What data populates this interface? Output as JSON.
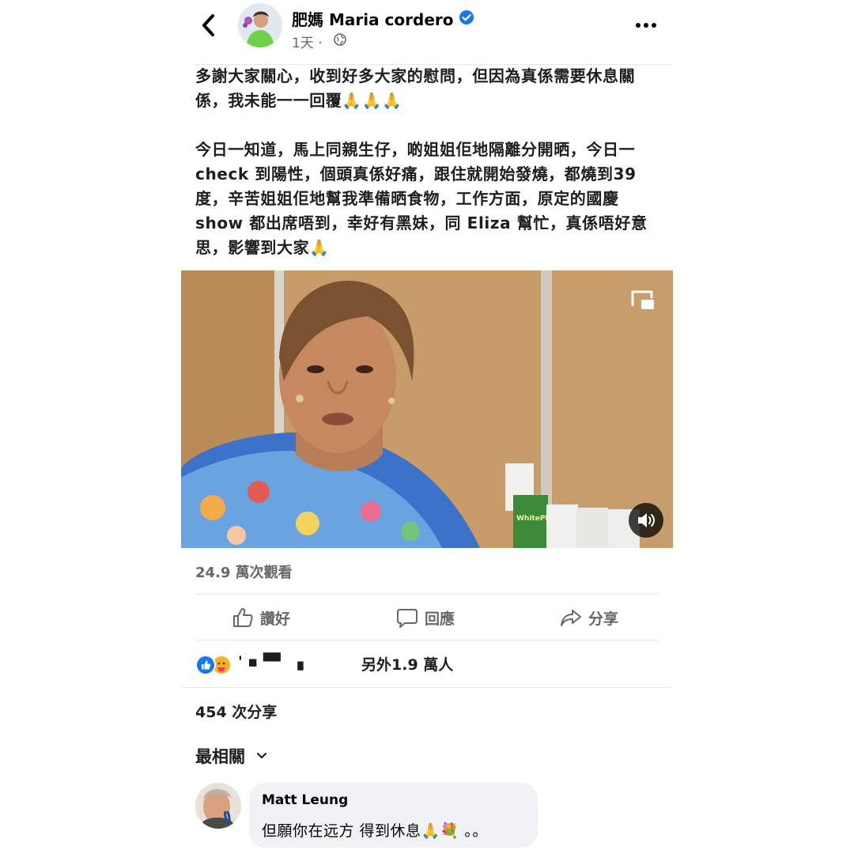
{
  "post": {
    "author": "肥媽 Maria cordero",
    "time": "1天 ·",
    "paragraphs": [
      "多謝大家關心，收到好多大家的慰問，但因為真係需要休息關係，我未能一一回覆🙏🙏🙏",
      "今日一知道，馬上同親生仔，啲姐姐佢地隔離分開晒，今日一check 到陽性，個頭真係好痛，跟住就開始發燒，都燒到39度，辛苦姐姐佢地幫我準備晒食物，工作方面，原定的國慶 show 都出席唔到，幸好有黑妹，同 Eliza 幫忙，真係唔好意思，影響到大家🙏"
    ]
  },
  "video": {
    "views": "24.9 萬次觀看",
    "product_label": "WhitePlant"
  },
  "actions": {
    "like": "讚好",
    "comment": "回應",
    "share": "分享"
  },
  "reactions": {
    "names": "'        ▪ ▀▘ ▗",
    "others": "另外1.9 萬人"
  },
  "shares": "454 次分享",
  "sort": "最相關",
  "comment": {
    "author": "Matt Leung",
    "text": "但願你在远方 得到休息🙏💐 。。"
  },
  "colors": {
    "accent": "#1877f2",
    "secondary_text": "#65676b",
    "bubble": "#f0f2f5"
  }
}
